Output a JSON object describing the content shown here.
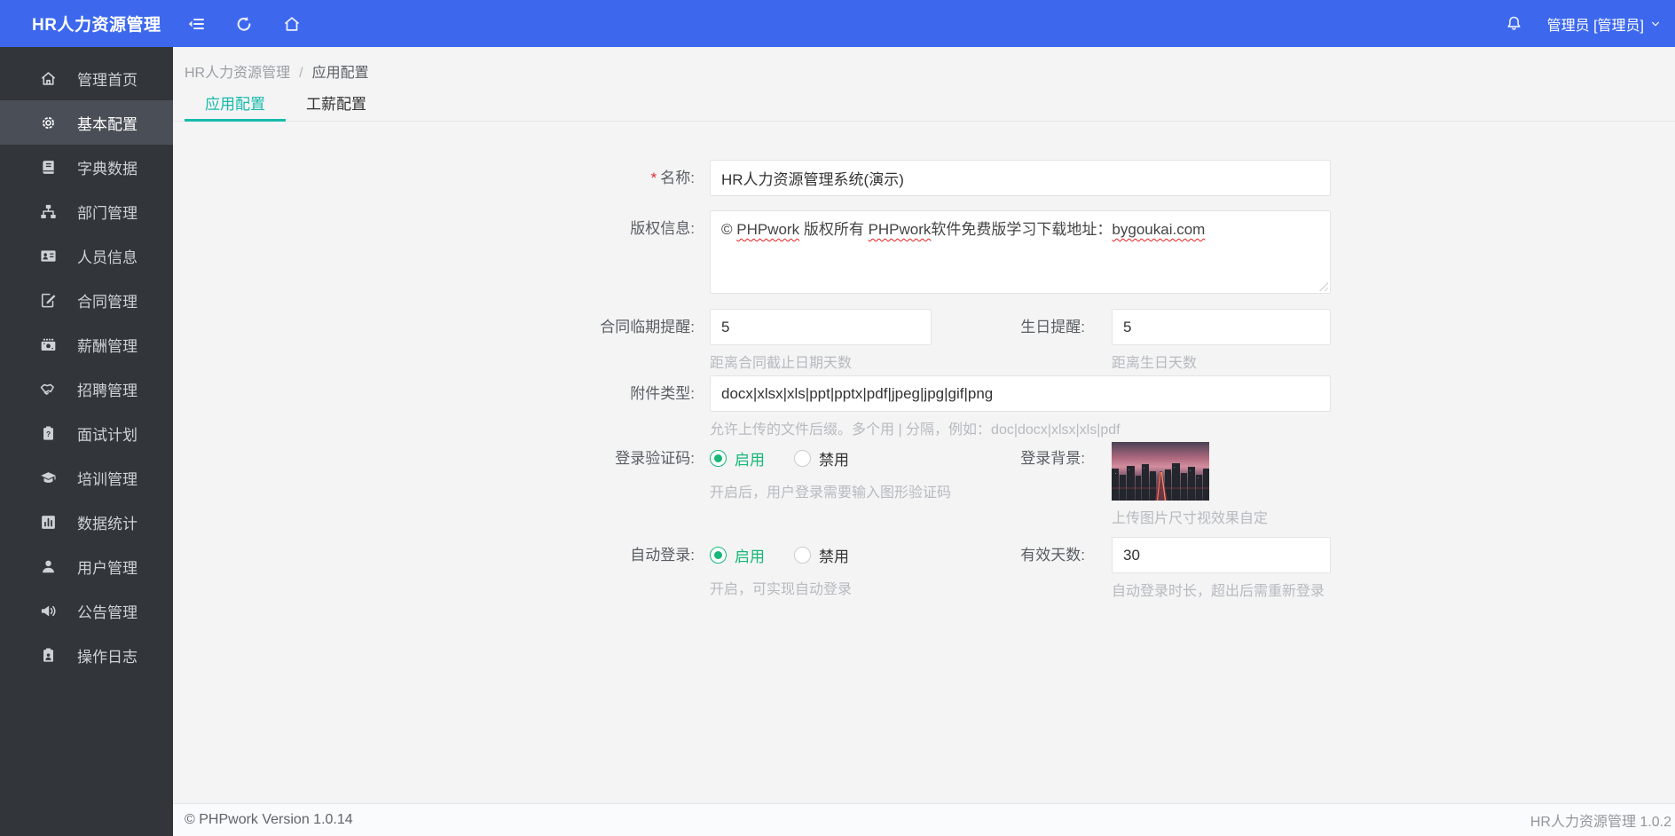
{
  "colors": {
    "header_blue": "#3d68ee",
    "sidebar_bg": "#32363b",
    "sidebar_active_bg": "#4a4f57",
    "accent_teal": "#16baaa",
    "accent_green": "#16b777"
  },
  "header": {
    "title": "HR人力资源管理",
    "icons": [
      "collapse-menu",
      "refresh",
      "home"
    ],
    "notification_icon": "bell",
    "user": "管理员 [管理员]"
  },
  "sidebar": {
    "items": [
      {
        "icon": "home",
        "label": "管理首页",
        "active": false
      },
      {
        "icon": "gear",
        "label": "基本配置",
        "active": true
      },
      {
        "icon": "book",
        "label": "字典数据",
        "active": false
      },
      {
        "icon": "sitemap",
        "label": "部门管理",
        "active": false
      },
      {
        "icon": "id-card",
        "label": "人员信息",
        "active": false
      },
      {
        "icon": "contract",
        "label": "合同管理",
        "active": false
      },
      {
        "icon": "salary",
        "label": "薪酬管理",
        "active": false
      },
      {
        "icon": "handshake",
        "label": "招聘管理",
        "active": false
      },
      {
        "icon": "interview",
        "label": "面试计划",
        "active": false
      },
      {
        "icon": "training",
        "label": "培训管理",
        "active": false
      },
      {
        "icon": "stats",
        "label": "数据统计",
        "active": false
      },
      {
        "icon": "user",
        "label": "用户管理",
        "active": false
      },
      {
        "icon": "announce",
        "label": "公告管理",
        "active": false
      },
      {
        "icon": "log",
        "label": "操作日志",
        "active": false
      }
    ]
  },
  "breadcrumb": {
    "root": "HR人力资源管理",
    "separator": "/",
    "current": "应用配置"
  },
  "tabs": [
    {
      "label": "应用配置",
      "active": true
    },
    {
      "label": "工薪配置",
      "active": false
    }
  ],
  "form": {
    "name": {
      "label": "名称:",
      "required_mark": "*",
      "value": "HR人力资源管理系统(演示)"
    },
    "copyright": {
      "label": "版权信息:",
      "segments": [
        {
          "text": "© ",
          "misspelled": false
        },
        {
          "text": "PHPwork",
          "misspelled": true
        },
        {
          "text": " 版权所有 ",
          "misspelled": false
        },
        {
          "text": "PHPwork",
          "misspelled": true
        },
        {
          "text": "软件免费版学习下载地址：",
          "misspelled": false
        },
        {
          "text": "bygoukai.com",
          "misspelled": true
        }
      ]
    },
    "contract_due_reminder": {
      "label": "合同临期提醒:",
      "value": "5",
      "hint": "距离合同截止日期天数"
    },
    "birthday_reminder": {
      "label": "生日提醒:",
      "value": "5",
      "hint": "距离生日天数"
    },
    "attachment_types": {
      "label": "附件类型:",
      "value": "docx|xlsx|xls|ppt|pptx|pdf|jpeg|jpg|gif|png",
      "hint": "允许上传的文件后缀。多个用 | 分隔，例如：doc|docx|xlsx|xls|pdf"
    },
    "login_captcha": {
      "label": "登录验证码:",
      "options": [
        {
          "label": "启用",
          "checked": true
        },
        {
          "label": "禁用",
          "checked": false
        }
      ],
      "hint": "开启后，用户登录需要输入图形验证码"
    },
    "login_background": {
      "label": "登录背景:",
      "image": "city-night-thumbnail",
      "hint": "上传图片尺寸视效果自定"
    },
    "auto_login": {
      "label": "自动登录:",
      "options": [
        {
          "label": "启用",
          "checked": true
        },
        {
          "label": "禁用",
          "checked": false
        }
      ],
      "hint": "开启，可实现自动登录"
    },
    "valid_days": {
      "label": "有效天数:",
      "value": "30",
      "hint": "自动登录时长，超出后需重新登录"
    }
  },
  "footer": {
    "left": "© PHPwork Version 1.0.14",
    "right": "HR人力资源管理 1.0.2"
  }
}
